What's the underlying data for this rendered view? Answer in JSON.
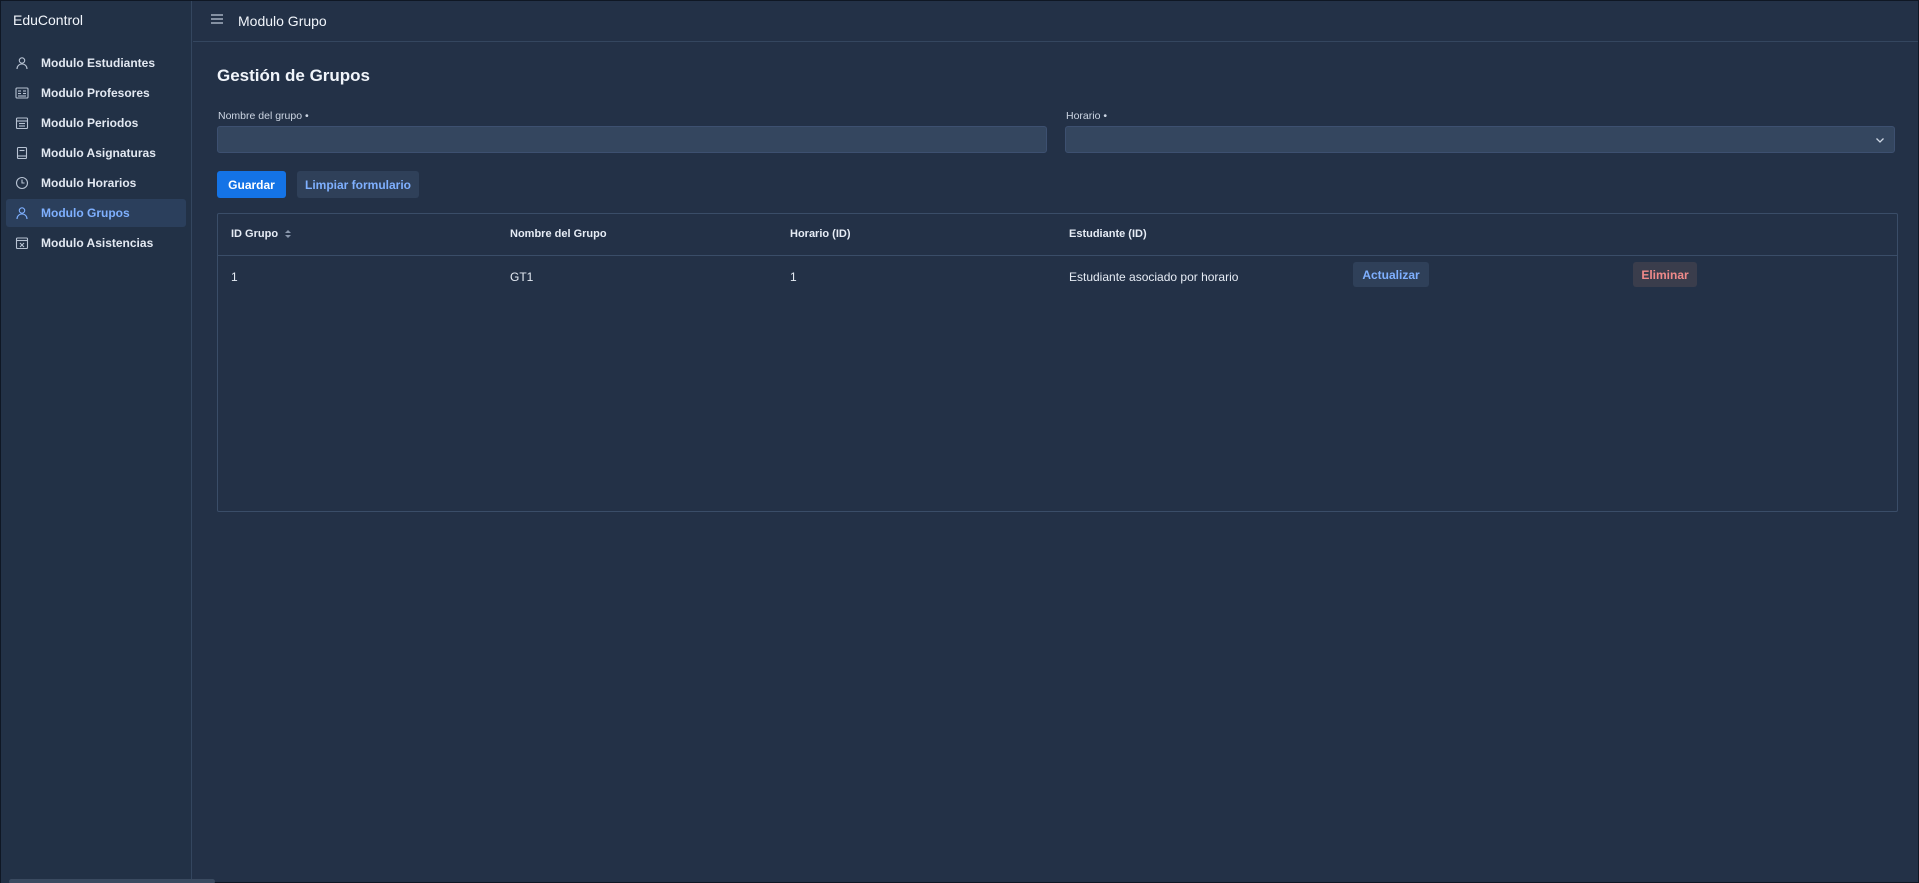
{
  "app": {
    "brand": "EduControl"
  },
  "sidebar": {
    "items": [
      {
        "label": "Modulo Estudiantes",
        "icon": "user-icon",
        "active": false
      },
      {
        "label": "Modulo Profesores",
        "icon": "id-card-icon",
        "active": false
      },
      {
        "label": "Modulo Periodos",
        "icon": "calendar-icon",
        "active": false
      },
      {
        "label": "Modulo Asignaturas",
        "icon": "book-icon",
        "active": false
      },
      {
        "label": "Modulo Horarios",
        "icon": "clock-icon",
        "active": false
      },
      {
        "label": "Modulo Grupos",
        "icon": "user-icon",
        "active": true
      },
      {
        "label": "Modulo Asistencias",
        "icon": "calendar-x-icon",
        "active": false
      }
    ]
  },
  "header": {
    "title": "Modulo Grupo"
  },
  "main": {
    "title": "Gestión de Grupos",
    "form": {
      "group_name_label": "Nombre del grupo",
      "group_name_value": "",
      "schedule_label": "Horario",
      "schedule_value": "",
      "required_mark": "•"
    },
    "buttons": {
      "save": "Guardar",
      "clear": "Limpiar formulario"
    },
    "table": {
      "headers": [
        "ID Grupo",
        "Nombre del Grupo",
        "Horario (ID)",
        "Estudiante (ID)"
      ],
      "rows": [
        {
          "id": "1",
          "name": "GT1",
          "schedule_id": "1",
          "student": "Estudiante asociado por horario",
          "update": "Actualizar",
          "delete": "Eliminar"
        }
      ]
    }
  },
  "colors": {
    "background": "#233147",
    "accent": "#1473e6",
    "link": "#7fb0ff",
    "danger": "#f08a8a"
  }
}
